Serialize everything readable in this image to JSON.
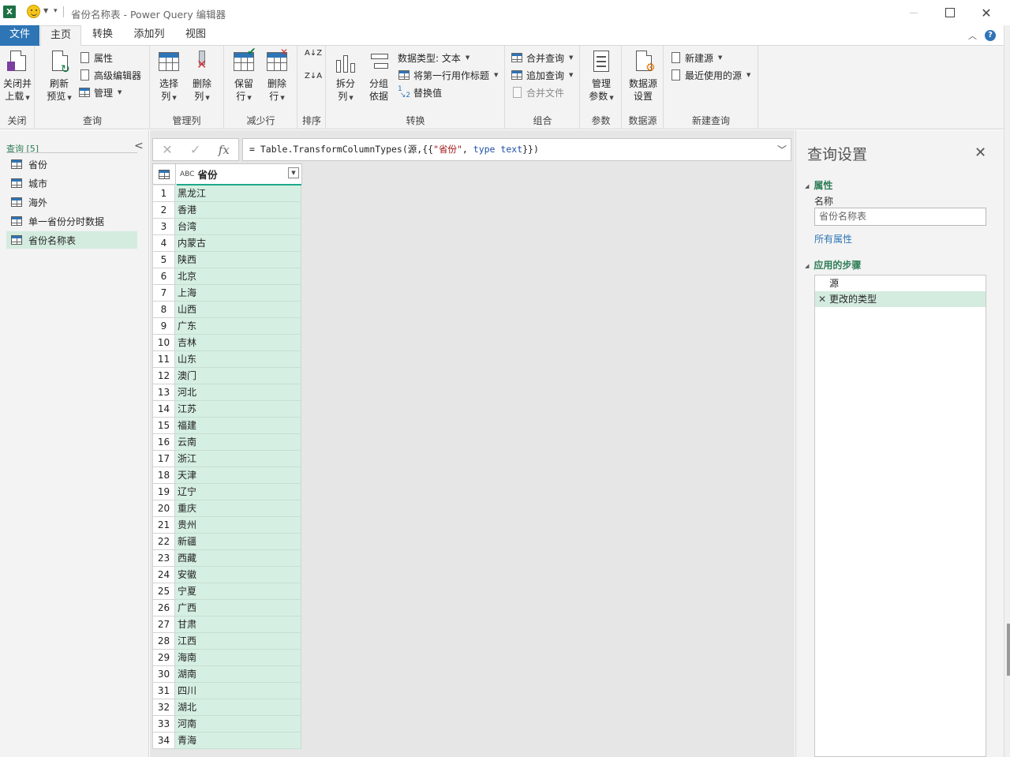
{
  "window": {
    "title": "省份名称表 - Power Query 编辑器",
    "app_icon_letter": "X",
    "controls": {
      "minimize": "—",
      "maximize": "☐",
      "close": "✕"
    }
  },
  "tabs": [
    {
      "label": "文件"
    },
    {
      "label": "主页"
    },
    {
      "label": "转换"
    },
    {
      "label": "添加列"
    },
    {
      "label": "视图"
    }
  ],
  "ribbon": {
    "groups": {
      "close": "关闭",
      "query": "查询",
      "manage_cols": "管理列",
      "reduce_rows": "减少行",
      "sort": "排序",
      "transform": "转换",
      "combine": "组合",
      "params": "参数",
      "datasource": "数据源",
      "newquery": "新建查询"
    },
    "buttons": {
      "close_load_1": "关闭并",
      "close_load_2": "上载",
      "refresh_1": "刷新",
      "refresh_2": "预览",
      "properties": "属性",
      "advanced_editor": "高级编辑器",
      "manage": "管理",
      "choose_cols_1": "选择",
      "choose_cols_2": "列",
      "remove_cols_1": "删除",
      "remove_cols_2": "列",
      "keep_rows_1": "保留",
      "keep_rows_2": "行",
      "remove_rows_1": "删除",
      "remove_rows_2": "行",
      "split_col_1": "拆分",
      "split_col_2": "列",
      "group_by_1": "分组",
      "group_by_2": "依据",
      "data_type": "数据类型: 文本",
      "first_row_header": "将第一行用作标题",
      "replace_values": "替换值",
      "merge_queries": "合并查询",
      "append_queries": "追加查询",
      "combine_files": "合并文件",
      "manage_params_1": "管理",
      "manage_params_2": "参数",
      "ds_settings_1": "数据源",
      "ds_settings_2": "设置",
      "new_source": "新建源",
      "recent_sources": "最近使用的源"
    }
  },
  "queries": {
    "header": "查询 [5]",
    "items": [
      {
        "label": "省份"
      },
      {
        "label": "城市"
      },
      {
        "label": "海外"
      },
      {
        "label": "单一省份分时数据"
      },
      {
        "label": "省份名称表"
      }
    ],
    "selected_index": 4
  },
  "formula": {
    "prefix": "= Table.TransformColumnTypes(源,{{",
    "string": "\"省份\"",
    "sep": ", ",
    "kw": "type",
    "space": " ",
    "kw2": "text",
    "suffix": "}})",
    "fx": "fx"
  },
  "table": {
    "column_header": "省份",
    "type_icon": "ABC",
    "rows": [
      "黑龙江",
      "香港",
      "台湾",
      "内蒙古",
      "陕西",
      "北京",
      "上海",
      "山西",
      "广东",
      "吉林",
      "山东",
      "澳门",
      "河北",
      "江苏",
      "福建",
      "云南",
      "浙江",
      "天津",
      "辽宁",
      "重庆",
      "贵州",
      "新疆",
      "西藏",
      "安徽",
      "宁夏",
      "广西",
      "甘肃",
      "江西",
      "海南",
      "湖南",
      "四川",
      "湖北",
      "河南",
      "青海"
    ]
  },
  "settings": {
    "title": "查询设置",
    "properties_section": "属性",
    "name_label": "名称",
    "name_value": "省份名称表",
    "all_properties": "所有属性",
    "steps_section": "应用的步骤",
    "steps": [
      {
        "label": "源"
      },
      {
        "label": "更改的类型"
      }
    ],
    "selected_step": 1
  },
  "colors": {
    "accent": "#2e75b6",
    "pq_green": "#2e7d57",
    "selection": "#d4ecdf",
    "column_bar": "#1da98a"
  }
}
